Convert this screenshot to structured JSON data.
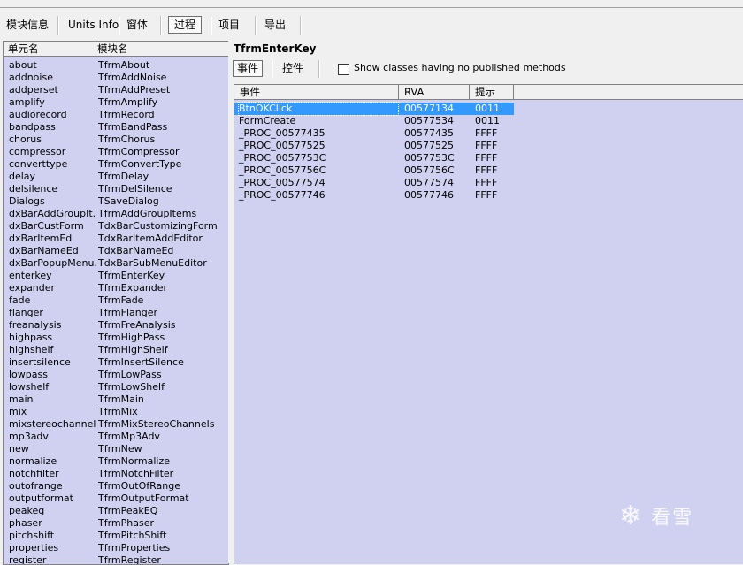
{
  "toolbar": {
    "tabs": [
      {
        "label": "模块信息"
      },
      {
        "label": "Units Info"
      },
      {
        "label": "窗体"
      },
      {
        "label": "过程"
      },
      {
        "label": "项目"
      },
      {
        "label": "导出"
      }
    ],
    "active_index": 3
  },
  "units": {
    "headers": {
      "unit": "单元名",
      "module": "模块名"
    },
    "rows": [
      [
        "about",
        "TfrmAbout"
      ],
      [
        "addnoise",
        "TfrmAddNoise"
      ],
      [
        "addperset",
        "TfrmAddPreset"
      ],
      [
        "amplify",
        "TfrmAmplify"
      ],
      [
        "audiorecord",
        "TfrmRecord"
      ],
      [
        "bandpass",
        "TfrmBandPass"
      ],
      [
        "chorus",
        "TfrmChorus"
      ],
      [
        "compressor",
        "TfrmCompressor"
      ],
      [
        "converttype",
        "TfrmConvertType"
      ],
      [
        "delay",
        "TfrmDelay"
      ],
      [
        "delsilence",
        "TfrmDelSilence"
      ],
      [
        "Dialogs",
        "TSaveDialog"
      ],
      [
        "dxBarAddGroupIt...",
        "TfrmAddGroupItems"
      ],
      [
        "dxBarCustForm",
        "TdxBarCustomizingForm"
      ],
      [
        "dxBarItemEd",
        "TdxBarItemAddEditor"
      ],
      [
        "dxBarNameEd",
        "TdxBarNameEd"
      ],
      [
        "dxBarPopupMenu...",
        "TdxBarSubMenuEditor"
      ],
      [
        "enterkey",
        "TfrmEnterKey"
      ],
      [
        "expander",
        "TfrmExpander"
      ],
      [
        "fade",
        "TfrmFade"
      ],
      [
        "flanger",
        "TfrmFlanger"
      ],
      [
        "freanalysis",
        "TfrmFreAnalysis"
      ],
      [
        "highpass",
        "TfrmHighPass"
      ],
      [
        "highshelf",
        "TfrmHighShelf"
      ],
      [
        "insertsilence",
        "TfrmInsertSilence"
      ],
      [
        "lowpass",
        "TfrmLowPass"
      ],
      [
        "lowshelf",
        "TfrmLowShelf"
      ],
      [
        "main",
        "TfrmMain"
      ],
      [
        "mix",
        "TfrmMix"
      ],
      [
        "mixstereochannels",
        "TfrmMixStereoChannels"
      ],
      [
        "mp3adv",
        "TfrmMp3Adv"
      ],
      [
        "new",
        "TfrmNew"
      ],
      [
        "normalize",
        "TfrmNormalize"
      ],
      [
        "notchfilter",
        "TfrmNotchFilter"
      ],
      [
        "outofrange",
        "TfrmOutOfRange"
      ],
      [
        "outputformat",
        "TfrmOutputFormat"
      ],
      [
        "peakeq",
        "TfrmPeakEQ"
      ],
      [
        "phaser",
        "TfrmPhaser"
      ],
      [
        "pitchshift",
        "TfrmPitchShift"
      ],
      [
        "properties",
        "TfrmProperties"
      ],
      [
        "register",
        "TfrmRegister"
      ]
    ]
  },
  "form": {
    "title": "TfrmEnterKey",
    "subtabs": [
      {
        "label": "事件"
      },
      {
        "label": "控件"
      }
    ],
    "active_subtab": 0,
    "checkbox_label": "Show classes having no published methods",
    "checkbox_checked": false
  },
  "events": {
    "headers": {
      "event": "事件",
      "rva": "RVA",
      "hint": "提示"
    },
    "selected_index": 0,
    "rows": [
      [
        "BtnOKClick",
        "00577134",
        "0011"
      ],
      [
        "FormCreate",
        "00577534",
        "0011"
      ],
      [
        "_PROC_00577435",
        "00577435",
        "FFFF"
      ],
      [
        "_PROC_00577525",
        "00577525",
        "FFFF"
      ],
      [
        "_PROC_0057753C",
        "0057753C",
        "FFFF"
      ],
      [
        "_PROC_0057756C",
        "0057756C",
        "FFFF"
      ],
      [
        "_PROC_00577574",
        "00577574",
        "FFFF"
      ],
      [
        "_PROC_00577746",
        "00577746",
        "FFFF"
      ]
    ]
  },
  "watermark": {
    "text": "看雪",
    "icon": "snowflake-icon"
  }
}
